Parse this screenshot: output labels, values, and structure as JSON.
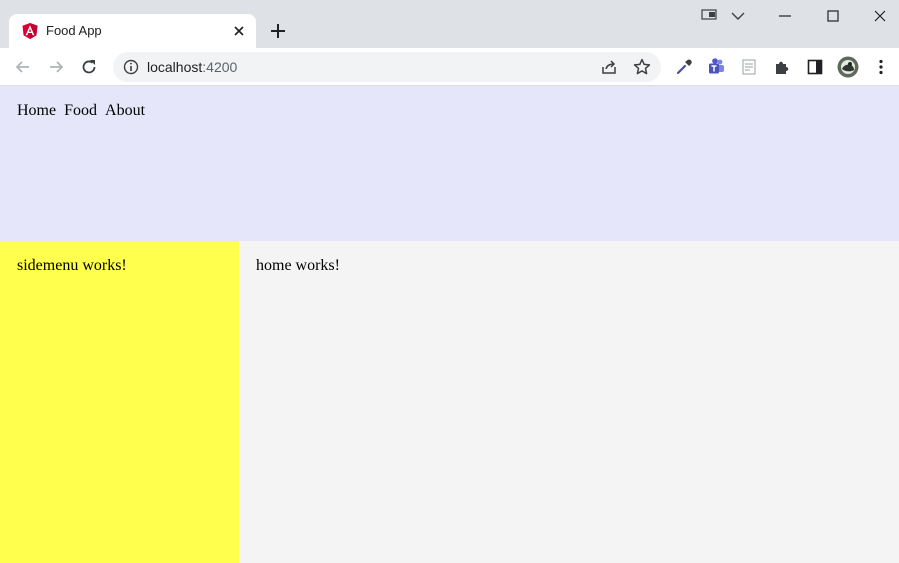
{
  "browser": {
    "tab": {
      "title": "Food App",
      "favicon": "angular-icon"
    },
    "address": {
      "host": "localhost",
      "port": ":4200"
    },
    "icons": {
      "back": "back-arrow-icon",
      "forward": "forward-arrow-icon",
      "reload": "reload-icon",
      "site_info": "info-icon",
      "share": "share-icon",
      "bookmark": "star-icon",
      "eyedropper": "eyedropper-icon",
      "teams": "teams-icon",
      "reader": "reader-icon",
      "extensions": "puzzle-icon",
      "sidepanel": "sidepanel-icon",
      "profile": "avatar",
      "menu": "kebab-menu-icon"
    },
    "colors": {
      "tab_strip": "#dee1e6",
      "omnibox": "#f1f3f4",
      "angular_red": "#dd0031",
      "teams_purple": "#5059c9"
    }
  },
  "app": {
    "nav": {
      "home": "Home",
      "food": "Food",
      "about": "About"
    },
    "sidemenu_text": "sidemenu works!",
    "home_text": "home works!",
    "colors": {
      "header_bg": "#e6e6fa",
      "sidemenu_bg": "#ffff4d",
      "main_bg": "#f4f4f4"
    }
  }
}
